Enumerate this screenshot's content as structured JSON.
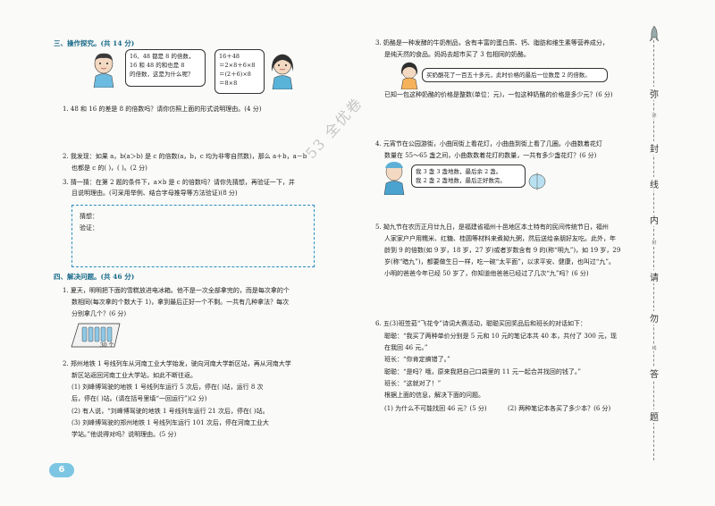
{
  "left": {
    "section3_title": "三、操作探究。(共 14 分)",
    "bubble_left": [
      "16、48 都是 8 的倍数，",
      "16 和 48 的和也是 8",
      "的倍数，这是为什么呢？"
    ],
    "bubble_right": [
      "16＋48",
      "＝2×8＋6×8",
      "＝(2＋6)×8",
      "＝8×8"
    ],
    "q1": "1. 48 和 16 的差是 8 的倍数吗？请你仿照上面的形式说明理由。(4 分)",
    "q2_line1": "2. 我发现：如果 a，b(a＞b) 是 c 的倍数(a，b，c 均为非零自然数)，那么 a＋b，a－b",
    "q2_line2": "也都是 c 的(      )，(      )。(2 分)",
    "q3_line1": "3. 猜一猜：在第 2 题的条件下，a×b 是 c 的倍数吗？请你先猜想，再验证一下，并",
    "q3_line2": "且说明理由。(可采用举例、结合字母推导等方法验证)(8 分)",
    "guess_label": "猜想：",
    "verify_label": "验证：",
    "section4_title": "四、解决问题。(共 46 分)",
    "p1_lines": [
      "1. 夏天，明明把下面的雪糕放进电冰箱。他不是一次全部拿完的，而是每次拿的个",
      "数相同(每次拿的个数大于 1)，拿到最后正好一个不剩。一共有几种拿法？每次",
      "分别拿几个？(6 分)"
    ],
    "popsicle_count": "30 个",
    "p2_lines": [
      "2. 郑州地铁 1 号线列车从河南工业大学始发，驶向河南大学新区站，再从河南大学",
      "新区站返回河南工业大学站，如此不断往返。",
      "(1) 刘峰博驾驶的地铁 1 号线列车运行 5 次后，停在(              )站，运行 8 次",
      "后，停在(              )站。(请在括号里填“一回运行”)(2 分)",
      "(2) 有人说，“刘峰博驾驶的地铁 1 号线列车运行 21 次后，停在(              )站。",
      "(3) 刘峰博驾驶的郑州地铁 1 号线列车运行 101 次后，停在河南工业大",
      "学站。”他说得对吗？说明理由。(5 分)"
    ],
    "page_number": "6"
  },
  "right": {
    "q3_lines": [
      "3. 奶酪是一种发酵的牛奶制品，含有丰富的蛋白质、钙、脂肪和维生素等营养成分，",
      "是纯天然的食品。妈妈去超市买了 3 包相同的奶酪。"
    ],
    "q3_bubble": "买奶酪花了一百五十多元，此时价格的最后一位数是 2 的倍数。",
    "q3_question": "已知一包这种奶酪的价格是整数(单位：元)，一包这种奶酪的价格是多少元？(6 分)",
    "q4_lines": [
      "4. 元宵节在公园游街，小曲同街上看花灯，小曲曲到街上看了几圈。小曲数着花灯",
      "数量在 55～65 盏之间，小曲数数着花灯的数量，一共有多少盏花灯？(6 分)"
    ],
    "q4_bubble": [
      "我 3 盏 3 盏地数，最后余 2 盏。",
      "我 2 盏 2 盏地数，最后正好数完。"
    ],
    "q5_lines": [
      "5. 拗九节在农历正月廿九日，是福建省福州十邑地区本土特有的民间传统节日，福州",
      "人家家户户用糯米、红糖、桂圆等材料来煮拗九粥，然后送给亲朋好友吃。此外，年",
      "龄到 9 的倍数(如 9 岁，18 岁，27 岁)或者岁数含有 9 的(称“明九”)，如 19 岁，29",
      "岁(称“暗九”)，都要做生日一样，吃一碗“太平面”，以求平安、健康，也叫过“九”。",
      "小明的爸爸今年已经 50 岁了，你知道他爸爸已经过了几次“九”吗？(6 分)"
    ],
    "q6_lines": [
      "6. 五(3)班笠茹“飞花令”诗词大赛活动，聪聪买回奖品后和班长的对话如下：",
      "聪聪：“我买了两种单价分别是 5 元和 10 元的笔记本共 40 本，共付了 300 元，现",
      "在我回 46 元。”",
      "班长：“你肯定搞错了。”",
      "聪聪：“是吗？哦，原来我把自己口袋里的 11 元一起合并找回的钱了。”",
      "班长：“这就对了！”",
      "根据上面的信息，解决下面的问题。"
    ],
    "q6_sub1": "(1) 为什么不可能找回 46 元？(5 分)",
    "q6_sub2": "(2) 两种笔记本各买了多少本？(6 分)"
  },
  "watermark": "53 全优卷",
  "sidebar": {
    "chars": [
      "弥",
      "封",
      "线",
      "内",
      "请",
      "勿",
      "答",
      "题"
    ],
    "small_marks": [
      "弥",
      "封",
      "线"
    ]
  }
}
